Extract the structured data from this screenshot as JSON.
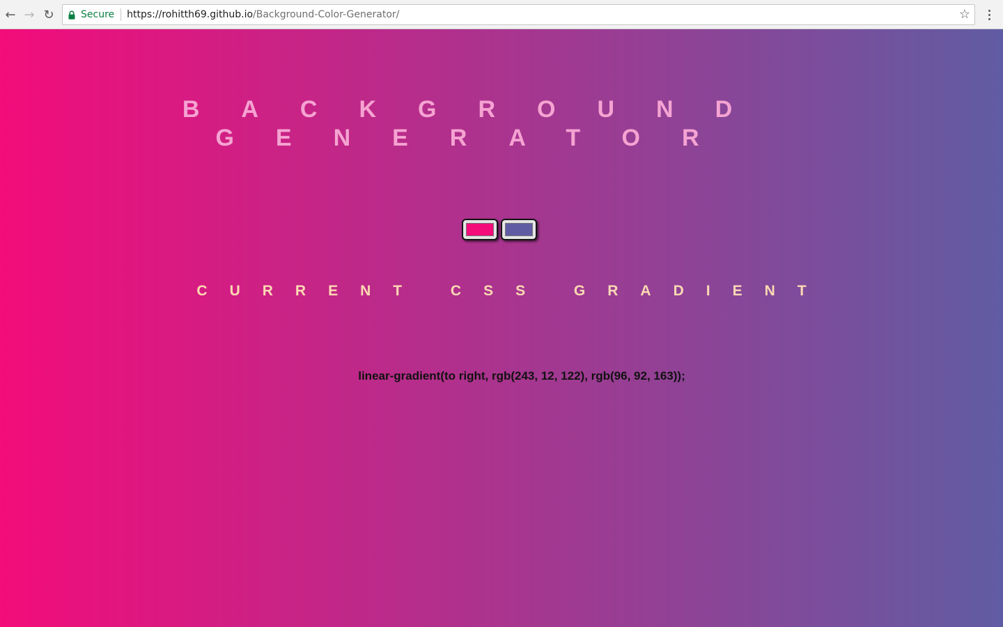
{
  "browser": {
    "secure_label": "Secure",
    "url_host": "https://rohitth69.github.io",
    "url_path": "/Background-Color-Generator/",
    "secure_color": "#0b8043"
  },
  "page": {
    "title_line1": "BACKGROUND",
    "title_line2": "GENERATOR",
    "color1": "#f30c7a",
    "color2": "#605ca3",
    "subtitle": "CURRENT CSS GRADIENT",
    "css_output": "linear-gradient(to right, rgb(243, 12, 122), rgb(96, 92, 163));",
    "title_color": "#f5a3d2",
    "subtitle_color": "#ffd9b3"
  }
}
